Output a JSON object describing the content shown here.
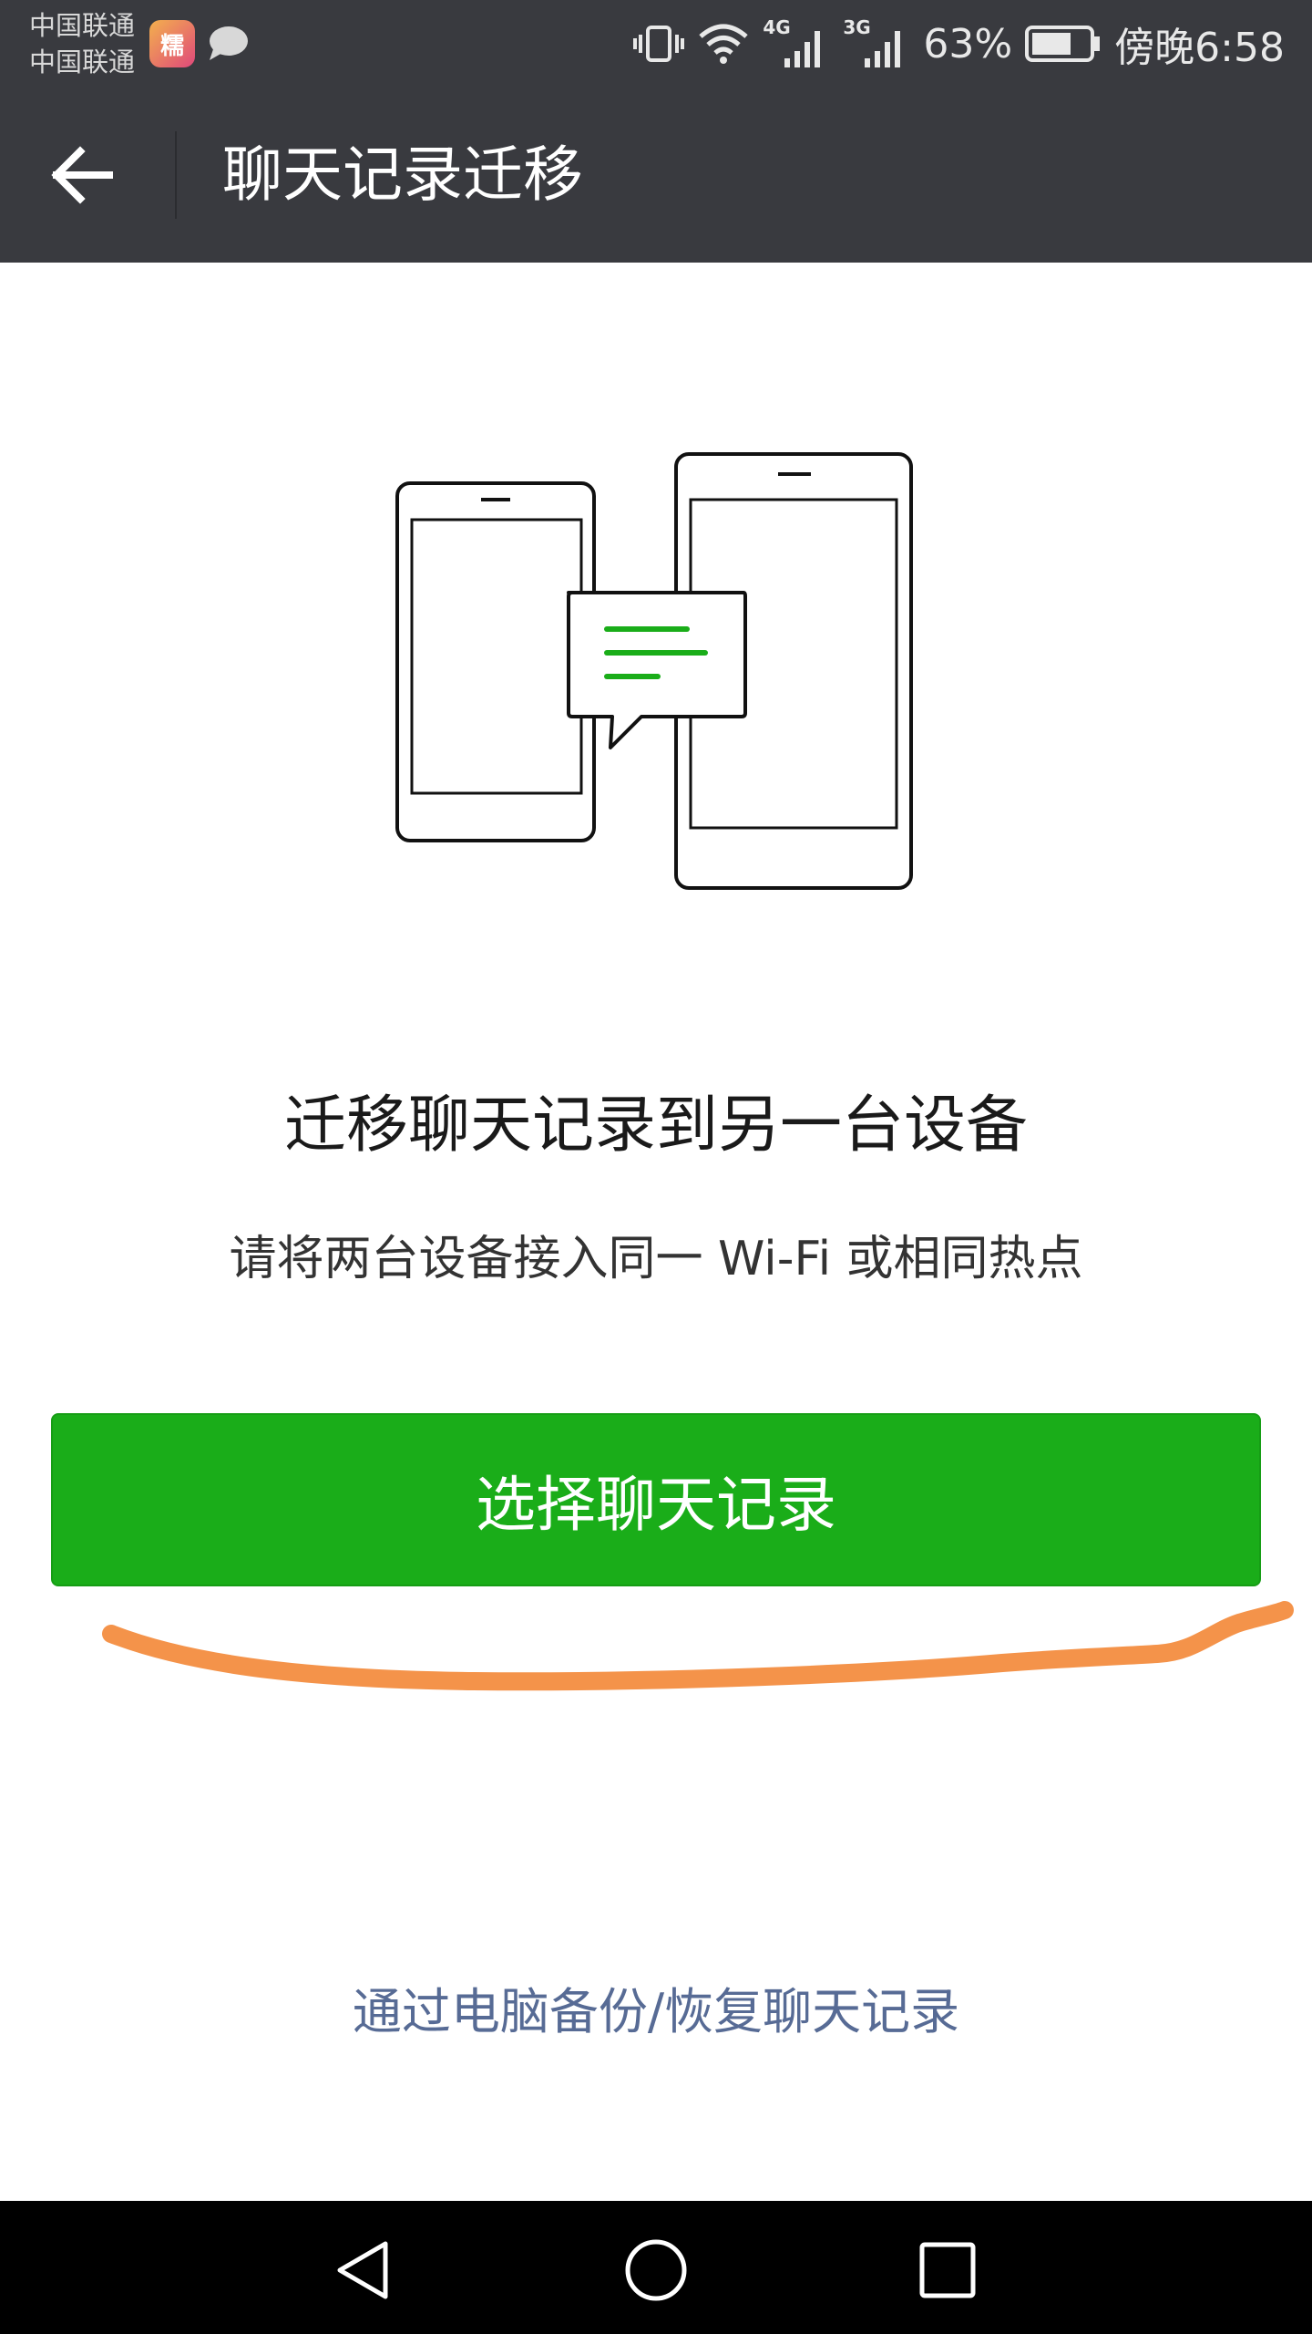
{
  "status_bar": {
    "carrier_1": "中国联通",
    "carrier_2": "中国联通",
    "app_badge_text": "糯",
    "network_1": "4G",
    "network_2": "3G",
    "battery_percent": "63%",
    "time": "傍晚6:58"
  },
  "nav": {
    "title": "聊天记录迁移"
  },
  "content": {
    "heading": "迁移聊天记录到另一台设备",
    "instruction": "请将两台设备接入同一 Wi-Fi 或相同热点",
    "primary_button": "选择聊天记录",
    "secondary_link": "通过电脑备份/恢复聊天记录"
  },
  "colors": {
    "toolbar": "#393a3f",
    "primary_green": "#1aad19",
    "link_blue": "#576b95",
    "annotation_orange": "#f4934a"
  },
  "icons": [
    "back-arrow-icon",
    "vibrate-icon",
    "wifi-icon",
    "signal-icon",
    "battery-icon",
    "chat-bubble-icon",
    "back-triangle-icon",
    "home-circle-icon",
    "recents-square-icon"
  ]
}
